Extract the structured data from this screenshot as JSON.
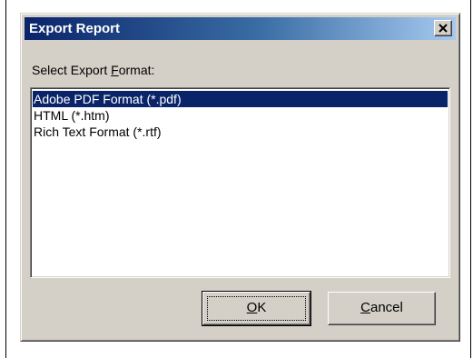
{
  "window": {
    "title": "Export Report",
    "close_glyph": "close-icon"
  },
  "form": {
    "format_label_prefix": "Select Export ",
    "format_label_mnemonic": "F",
    "format_label_suffix": "ormat:"
  },
  "formats": {
    "items": [
      {
        "label": "Adobe PDF Format (*.pdf)",
        "selected": true
      },
      {
        "label": "HTML (*.htm)",
        "selected": false
      },
      {
        "label": "Rich Text Format (*.rtf)",
        "selected": false
      }
    ]
  },
  "buttons": {
    "ok_mnemonic": "O",
    "ok_rest": "K",
    "cancel_mnemonic": "C",
    "cancel_rest": "ancel"
  },
  "colors": {
    "title_start": "#0a246a",
    "title_end": "#a6caf0",
    "selection": "#0a246a",
    "face": "#d4d0c8"
  }
}
